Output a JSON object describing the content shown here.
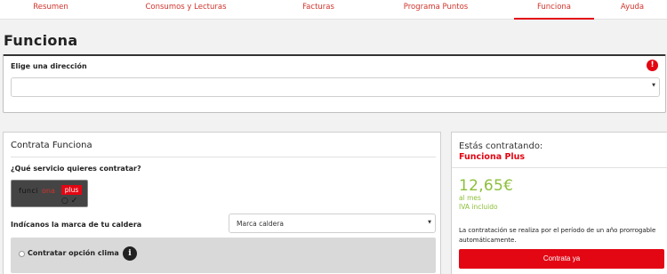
{
  "nav": {
    "tabs": [
      {
        "label": "Resumen"
      },
      {
        "label": "Consumos y Lecturas"
      },
      {
        "label": "Facturas"
      },
      {
        "label": "Programa Puntos"
      },
      {
        "label": "Funciona",
        "active": true
      },
      {
        "label": "Ayuda"
      }
    ]
  },
  "page": {
    "title": "Funciona"
  },
  "address": {
    "label": "Elige una dirección",
    "selected": "",
    "warning_icon": "exclamation-icon"
  },
  "contract": {
    "title": "Contrata Funciona",
    "service_question": "¿Qué servicio quieres contratar?",
    "service_card": {
      "logo_text_dark": "funci",
      "logo_text_accent": "ona",
      "badge": "plus"
    },
    "brand_label": "Indícanos la marca de tu caldera",
    "brand_select": {
      "placeholder": "Marca caldera"
    },
    "clima": {
      "label": "Contratar opción clima",
      "info_icon": "info-icon"
    }
  },
  "summary": {
    "label": "Estás contratando:",
    "product": "Funciona Plus",
    "price": "12,65€",
    "period": "al mes",
    "tax_note": "IVA incluido",
    "terms": "La contratación se realiza por el período de un año prorrogable automáticamente.",
    "cta": "Contrata ya"
  },
  "colors": {
    "accent": "#e30613",
    "price_green": "#8cbf3a",
    "background": "#f2f2f2"
  }
}
